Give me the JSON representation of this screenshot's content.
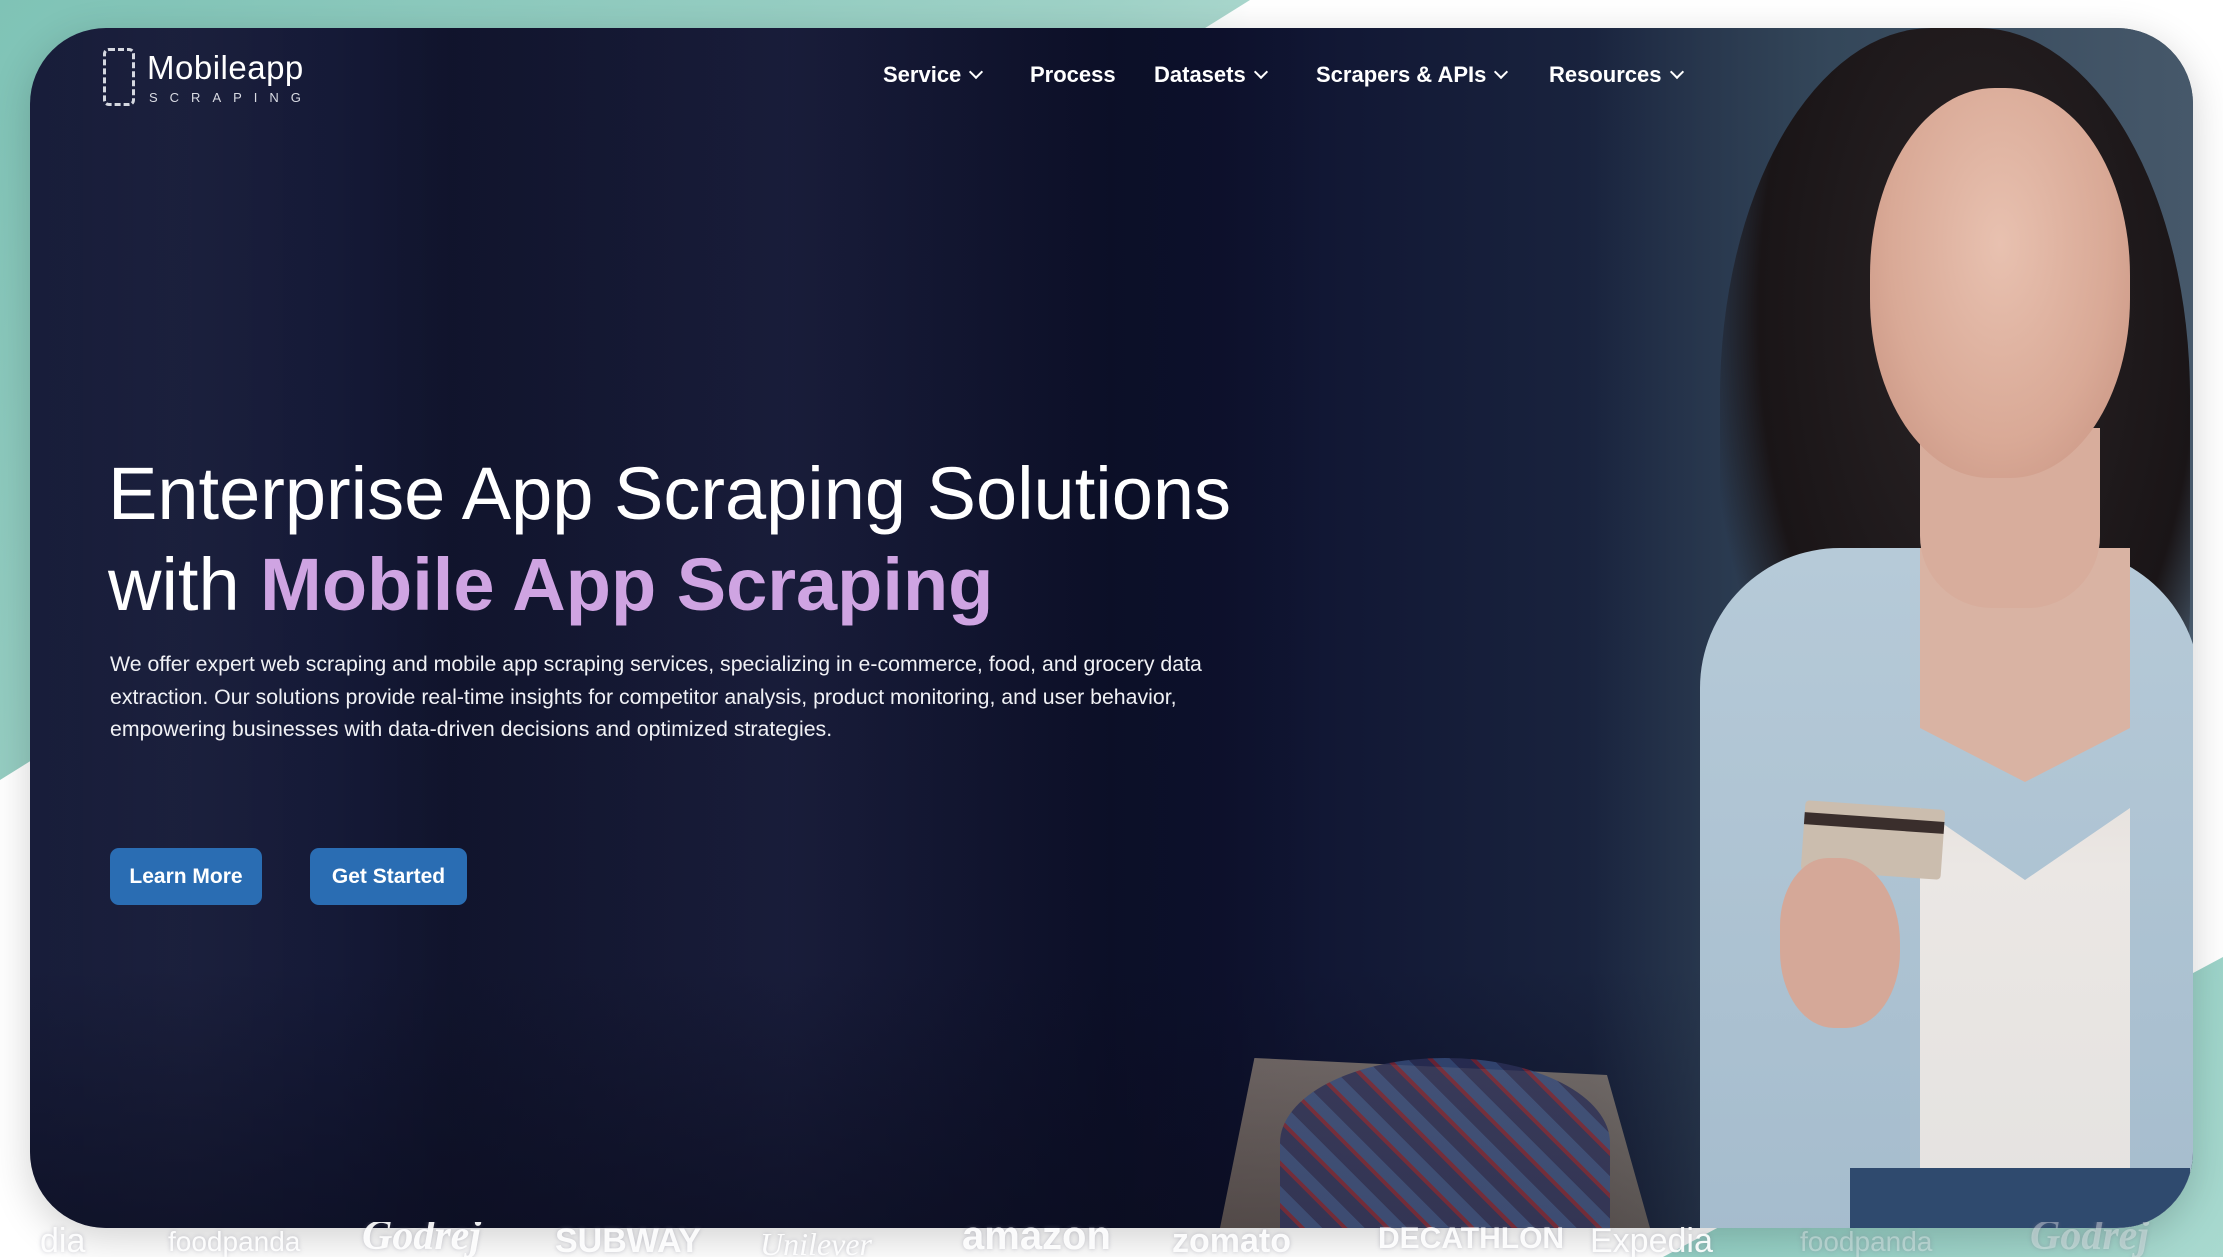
{
  "brand": {
    "name": "Mobileapp",
    "tagline": "SCRAPING"
  },
  "nav": {
    "items": [
      {
        "label": "Service",
        "has_dropdown": true,
        "icon": "chevron-down-icon"
      },
      {
        "label": "Process",
        "has_dropdown": false
      },
      {
        "label": "Datasets",
        "has_dropdown": true,
        "icon": "chevron-down-icon"
      },
      {
        "label": "Scrapers & APIs",
        "has_dropdown": true,
        "icon": "chevron-down-icon"
      },
      {
        "label": "Resources",
        "has_dropdown": true,
        "icon": "chevron-down-icon"
      }
    ]
  },
  "hero": {
    "headline_line1": "Enterprise App Scraping Solutions",
    "headline_with": "with",
    "headline_accent": "Mobile App Scraping",
    "description": "We offer expert web scraping and mobile app scraping services, specializing in e-commerce, food, and grocery data extraction. Our solutions provide real-time insights for competitor analysis, product monitoring, and user behavior, empowering businesses with data-driven decisions and optimized strategies.",
    "buttons": {
      "learn_more": "Learn More",
      "get_started": "Get Started"
    }
  },
  "client_logos": [
    "dia",
    "foodpanda",
    "Godrej",
    "SUBWAY",
    "Unilever",
    "amazon",
    "zomato",
    "DECATHLON",
    "Expedia",
    "foodpanda",
    "Godrej"
  ],
  "colors": {
    "accent_purple": "#cfa4e2",
    "button_blue": "#2a6db3",
    "hero_bg": "#121634",
    "teal_backdrop": "#8fcbbf"
  }
}
